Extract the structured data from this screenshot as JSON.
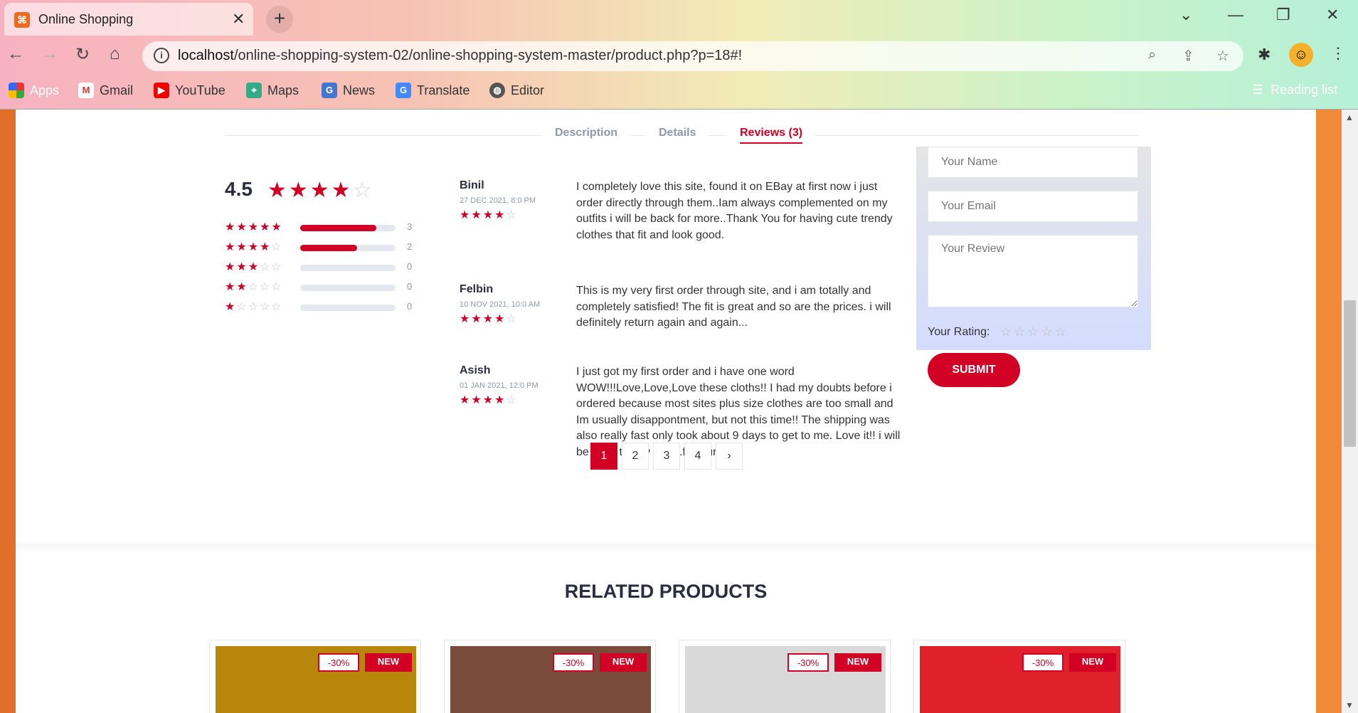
{
  "browser": {
    "tab_title": "Online Shopping",
    "tab_close": "✕",
    "new_tab": "+",
    "url_host": "localhost",
    "url_path": "/online-shopping-system-02/online-shopping-system-master/product.php?p=18#!",
    "bookmarks": [
      "Apps",
      "Gmail",
      "YouTube",
      "Maps",
      "News",
      "Translate",
      "Editor"
    ],
    "reading_list": "Reading list"
  },
  "product_tabs": [
    "Description",
    "Details",
    "Reviews (3)"
  ],
  "rating": {
    "average": "4.5",
    "average_stars": 4,
    "breakdown": [
      {
        "stars": 5,
        "fraction": 0.8,
        "count": "3"
      },
      {
        "stars": 4,
        "fraction": 0.6,
        "count": "2"
      },
      {
        "stars": 3,
        "fraction": 0,
        "count": "0"
      },
      {
        "stars": 2,
        "fraction": 0,
        "count": "0"
      },
      {
        "stars": 1,
        "fraction": 0,
        "count": "0"
      }
    ]
  },
  "reviews": [
    {
      "name": "Binil",
      "date": "27 DEC 2021, 8:0 PM",
      "stars": 4,
      "text": "I completely love this site, found it on EBay at first now i just order directly through them..Iam always complemented on my outfits i will be back for more..Thank You for having cute trendy clothes that fit and look good."
    },
    {
      "name": "Felbin",
      "date": "10 NOV 2021, 10:0 AM",
      "stars": 4,
      "text": "This is my very first order through site, and i am totally and completely satisfied! The fit is great and so are the prices. i will definitely return again and again..."
    },
    {
      "name": "Asish",
      "date": "01 JAN 2021, 12:0 PM",
      "stars": 4,
      "text": "I just got my first order and i have one word WOW!!!Love,Love,Love these cloths!! I had my doubts before i ordered because most sites plus size clothes are too small and Im usually disappontment, but not this time!! The shipping was also really fast only took about 9 days to get to me. Love it!! i will be back to buy more.for Sure!"
    }
  ],
  "review_form": {
    "name_placeholder": "Your Name",
    "email_placeholder": "Your Email",
    "review_placeholder": "Your Review",
    "rating_label": "Your Rating:",
    "submit_label": "SUBMIT"
  },
  "pagination": [
    "1",
    "2",
    "3",
    "4",
    "›"
  ],
  "related": {
    "title": "RELATED PRODUCTS",
    "products": [
      {
        "sale": "-30%",
        "badge": "NEW",
        "color": "#b8860b"
      },
      {
        "sale": "-30%",
        "badge": "NEW",
        "color": "#7a4a3a"
      },
      {
        "sale": "-30%",
        "badge": "NEW",
        "color": "#d9d9d9"
      },
      {
        "sale": "-30%",
        "badge": "NEW",
        "color": "#e0202a"
      }
    ]
  },
  "colors": {
    "accent": "#d10024",
    "text_dark": "#2b2d42",
    "muted": "#8d99ae"
  }
}
